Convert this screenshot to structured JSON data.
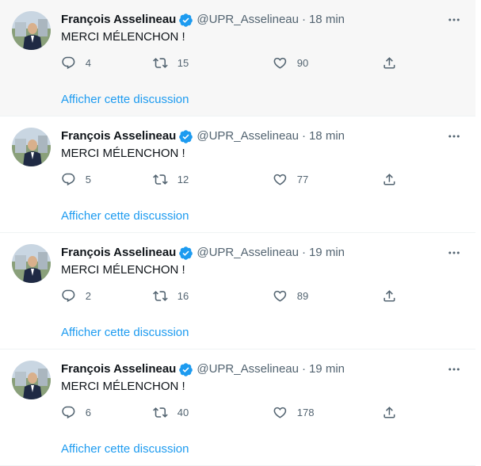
{
  "feed": {
    "tweets": [
      {
        "author_name": "François Asselineau",
        "handle": "@UPR_Asselineau",
        "separator": "·",
        "time": "18 min",
        "text": "MERCI MÉLENCHON !",
        "replies": "4",
        "retweets": "15",
        "likes": "90",
        "show_thread": "Afficher cette discussion"
      },
      {
        "author_name": "François Asselineau",
        "handle": "@UPR_Asselineau",
        "separator": "·",
        "time": "18 min",
        "text": "MERCI MÉLENCHON !",
        "replies": "5",
        "retweets": "12",
        "likes": "77",
        "show_thread": "Afficher cette discussion"
      },
      {
        "author_name": "François Asselineau",
        "handle": "@UPR_Asselineau",
        "separator": "·",
        "time": "19 min",
        "text": "MERCI MÉLENCHON !",
        "replies": "2",
        "retweets": "16",
        "likes": "89",
        "show_thread": "Afficher cette discussion"
      },
      {
        "author_name": "François Asselineau",
        "handle": "@UPR_Asselineau",
        "separator": "·",
        "time": "19 min",
        "text": "MERCI MÉLENCHON !",
        "replies": "6",
        "retweets": "40",
        "likes": "178",
        "show_thread": "Afficher cette discussion"
      }
    ]
  },
  "icons": {
    "verified": "verified-badge-icon",
    "more": "more-dots-icon",
    "reply": "reply-icon",
    "retweet": "retweet-icon",
    "like": "heart-icon",
    "share": "share-icon"
  },
  "colors": {
    "accent": "#1d9bf0",
    "text_primary": "#0f1419",
    "text_secondary": "#536471",
    "hover_background": "#f7f7f7",
    "divider": "#eff3f4"
  }
}
